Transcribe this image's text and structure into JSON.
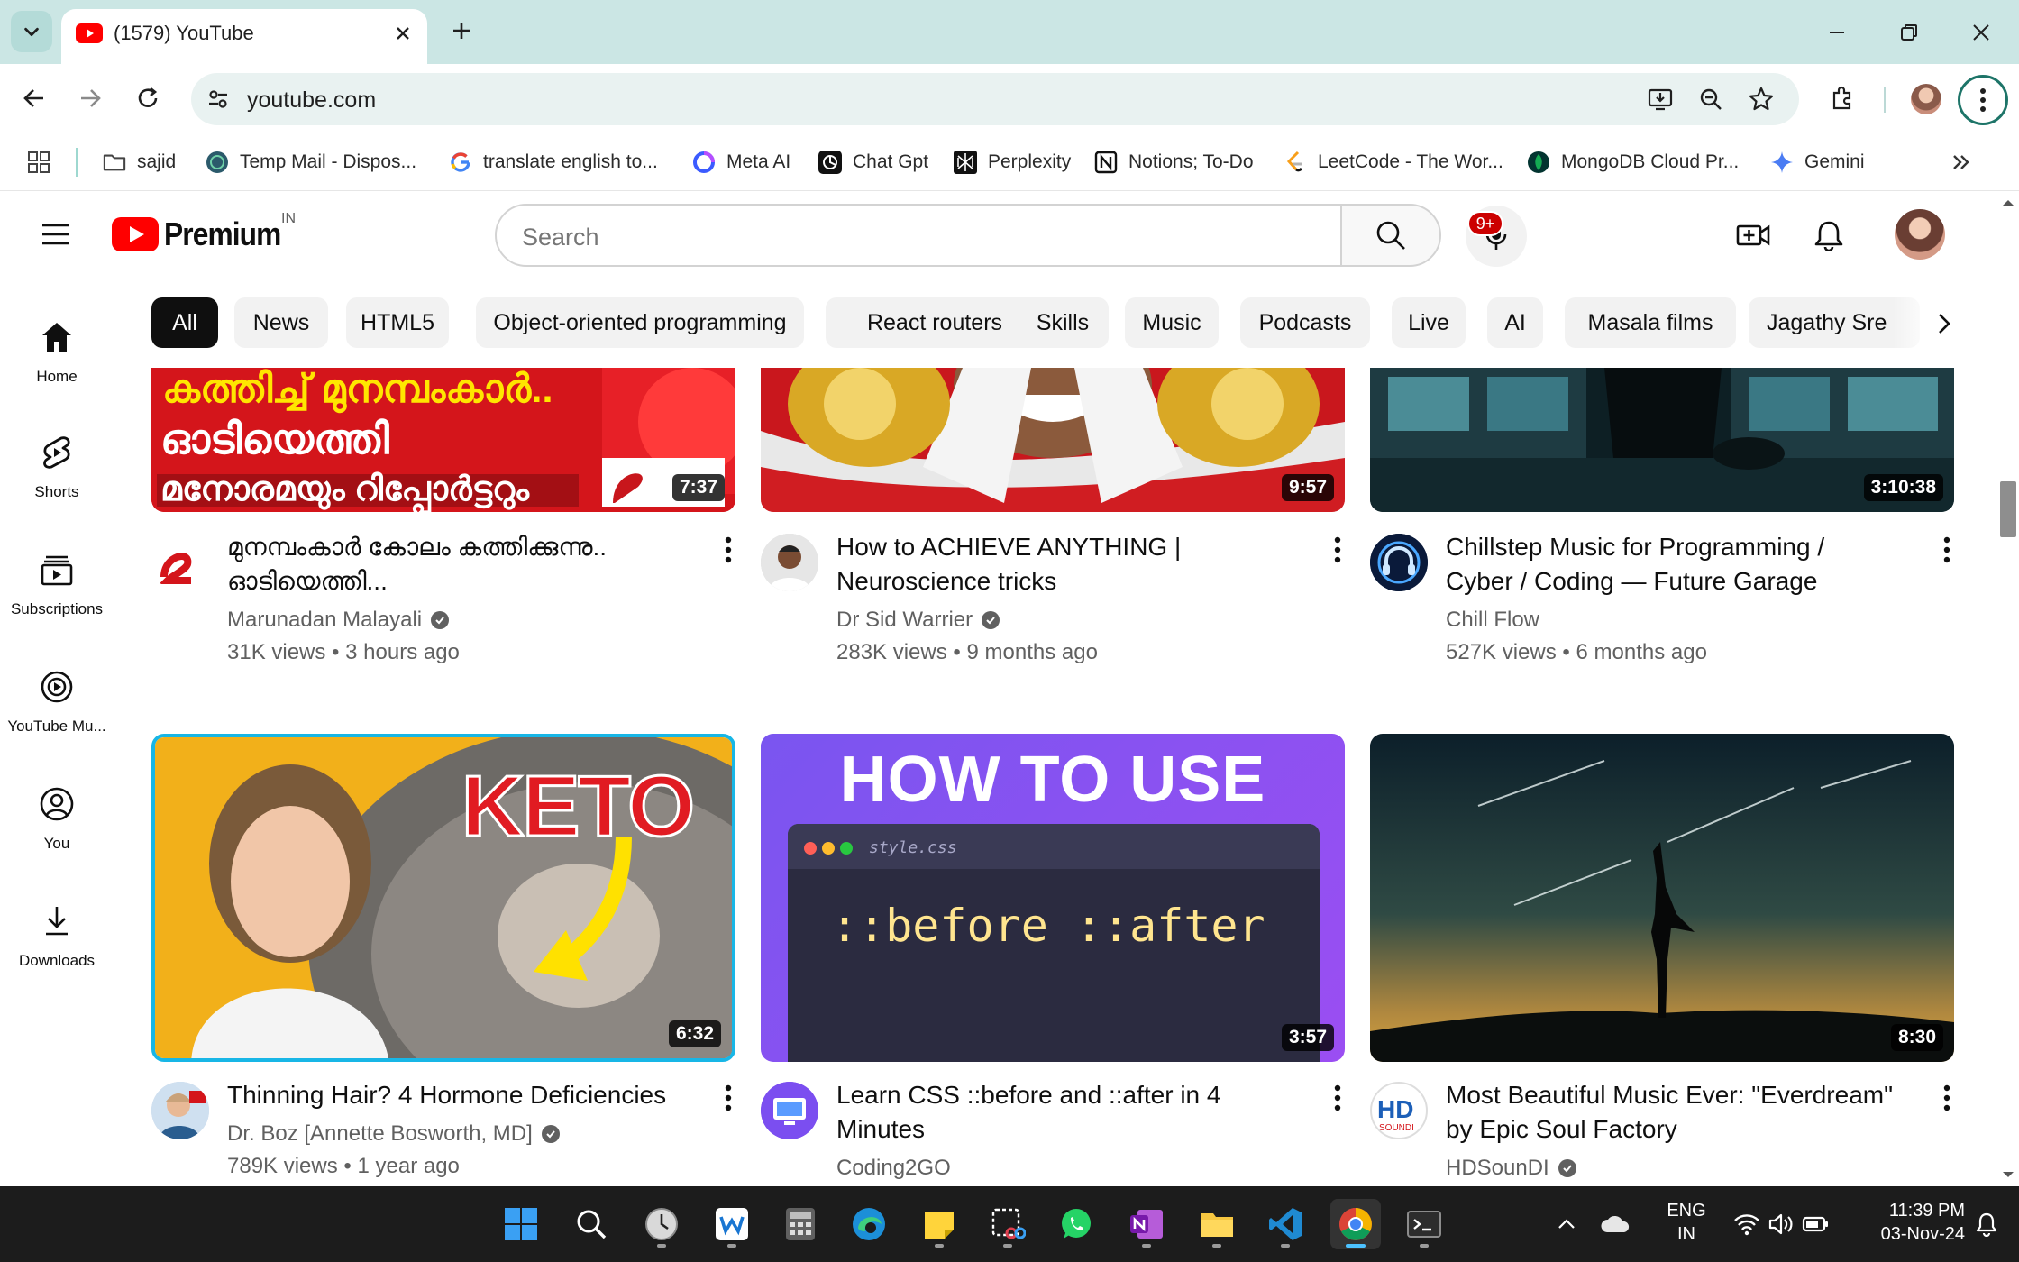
{
  "browser": {
    "tab_title": "(1579) YouTube",
    "url": "youtube.com",
    "bookmarks": [
      {
        "label": "sajid",
        "icon": "folder-icon"
      },
      {
        "label": "Temp Mail - Dispos...",
        "icon": "tempmail-favicon"
      },
      {
        "label": "translate english to...",
        "icon": "google-favicon"
      },
      {
        "label": "Meta AI",
        "icon": "meta-ai-favicon"
      },
      {
        "label": "Chat Gpt",
        "icon": "chatgpt-favicon"
      },
      {
        "label": "Perplexity",
        "icon": "perplexity-favicon"
      },
      {
        "label": "Notions; To-Do",
        "icon": "notion-favicon"
      },
      {
        "label": "LeetCode - The Wor...",
        "icon": "leetcode-favicon"
      },
      {
        "label": "MongoDB Cloud Pr...",
        "icon": "mongodb-favicon"
      },
      {
        "label": "Gemini",
        "icon": "gemini-favicon"
      }
    ]
  },
  "youtube": {
    "logo_text": "Premium",
    "country_code": "IN",
    "search_placeholder": "Search",
    "notification_count": "9+",
    "chips": [
      "All",
      "News",
      "HTML5",
      "Object-oriented programming",
      "React routers",
      "Skills",
      "Music",
      "Podcasts",
      "Live",
      "AI",
      "Masala films",
      "Jagathy Sre"
    ],
    "active_chip": "All",
    "sidebar": [
      {
        "label": "Home",
        "icon": "home-icon"
      },
      {
        "label": "Shorts",
        "icon": "shorts-icon"
      },
      {
        "label": "Subscriptions",
        "icon": "subscriptions-icon"
      },
      {
        "label": "YouTube Mu...",
        "icon": "youtube-music-icon"
      },
      {
        "label": "You",
        "icon": "you-icon"
      },
      {
        "label": "Downloads",
        "icon": "downloads-icon"
      }
    ],
    "videos": [
      {
        "title": "മുനമ്പംകാർ കോലം കത്തിക്കുന്നു.. ഓടിയെത്തി...",
        "channel": "Marunadan Malayali",
        "verified": true,
        "views": "31K views",
        "age": "3 hours ago",
        "duration": "7:37",
        "thumb_text": [
          "കത്തിച്ച് മുനമ്പംകാർ..",
          "ഓടിയെത്തി",
          "മനോരമയും റിപ്പോർട്ടറും"
        ]
      },
      {
        "title": "How to ACHIEVE ANYTHING | Neuroscience tricks",
        "channel": "Dr Sid Warrier",
        "verified": true,
        "views": "283K views",
        "age": "9 months ago",
        "duration": "9:57"
      },
      {
        "title": "Chillstep Music for Programming / Cyber / Coding — Future Garage Playlist",
        "channel": "Chill Flow",
        "verified": false,
        "views": "527K views",
        "age": "6 months ago",
        "duration": "3:10:38"
      },
      {
        "title": "Thinning Hair? 4 Hormone Deficiencies",
        "channel": "Dr. Boz [Annette Bosworth, MD]",
        "verified": true,
        "views": "789K views",
        "age": "1 year ago",
        "duration": "6:32",
        "thumb_text": [
          "KETO"
        ]
      },
      {
        "title": "Learn CSS ::before and ::after in 4 Minutes",
        "channel": "Coding2GO",
        "verified": false,
        "duration": "3:57",
        "thumb_text": [
          "HOW TO USE",
          "style.css",
          "::before ::after"
        ]
      },
      {
        "title": "Most Beautiful Music Ever: \"Everdream\" by Epic Soul Factory",
        "channel": "HDSounDI",
        "verified": true,
        "duration": "8:30"
      }
    ]
  },
  "taskbar": {
    "language": "ENG",
    "region": "IN",
    "time": "11:39 PM",
    "date": "03-Nov-24",
    "accent": "#4cc2ff"
  },
  "colors": {
    "chrome_tabbar": "#cbe6e4",
    "omnibox": "#e9f2f1",
    "yt_red": "#ff0000",
    "badge_red": "#cc0000"
  }
}
